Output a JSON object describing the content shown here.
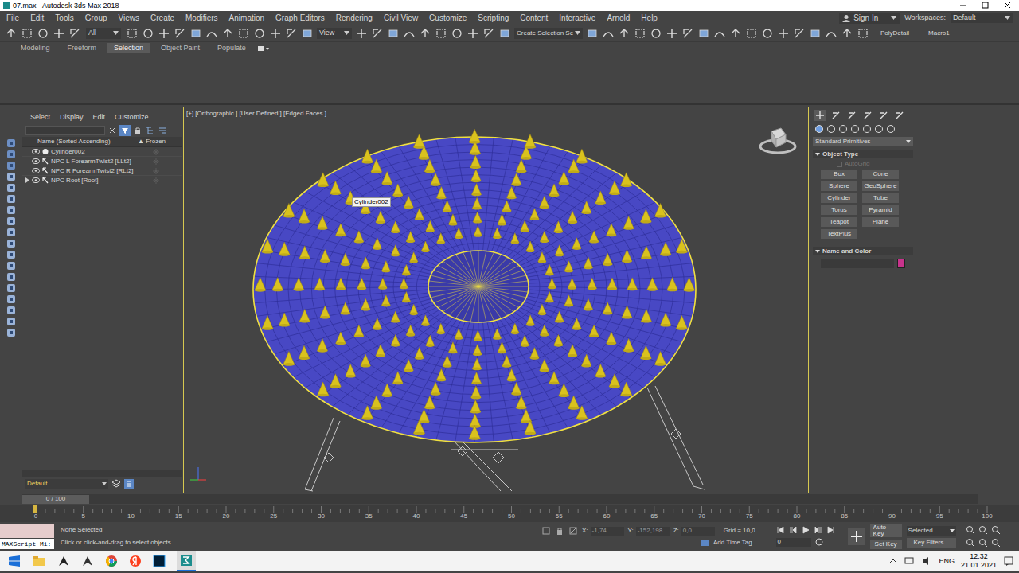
{
  "window": {
    "title": "07.max - Autodesk 3ds Max 2018"
  },
  "menu_bar": {
    "items": [
      "File",
      "Edit",
      "Tools",
      "Group",
      "Views",
      "Create",
      "Modifiers",
      "Animation",
      "Graph Editors",
      "Rendering",
      "Civil View",
      "Customize",
      "Scripting",
      "Content",
      "Interactive",
      "Arnold",
      "Help"
    ],
    "sign_in": "Sign In",
    "workspaces_label": "Workspaces:",
    "workspace": "Default"
  },
  "main_toolbar": {
    "filter": "All",
    "reference": "View",
    "selection_set": "Create Selection Se",
    "buttons": [
      "PolyDetail",
      "Macro1"
    ]
  },
  "ribbon": {
    "tabs": [
      {
        "label": "Modeling",
        "selected": false
      },
      {
        "label": "Freeform",
        "selected": false
      },
      {
        "label": "Selection",
        "selected": true
      },
      {
        "label": "Object Paint",
        "selected": false
      },
      {
        "label": "Populate",
        "selected": false
      }
    ]
  },
  "scene_explorer": {
    "menu": [
      "Select",
      "Display",
      "Edit",
      "Customize"
    ],
    "columns": [
      "Name (Sorted Ascending)",
      "▲ Frozen"
    ],
    "rows": [
      {
        "name": "Cylinder002",
        "kind": "geometry",
        "expandable": false,
        "expanded": false
      },
      {
        "name": "NPC L ForearmTwist2 [LLt2]",
        "kind": "bone",
        "expandable": false,
        "expanded": false
      },
      {
        "name": "NPC R ForearmTwist2 [RLt2]",
        "kind": "bone",
        "expandable": false,
        "expanded": false
      },
      {
        "name": "NPC Root [Root]",
        "kind": "bone",
        "expandable": true,
        "expanded": false
      }
    ],
    "layer": "Default"
  },
  "viewport": {
    "label": "[+] [Orthographic ] [User Defined ] [Edged Faces ]",
    "tooltip": "Cylinder002",
    "active": true
  },
  "command_panel": {
    "category": "Standard Primitives",
    "object_type": {
      "title": "Object Type",
      "autogrid": {
        "label": "AutoGrid",
        "checked": false,
        "disabled": true
      },
      "buttons": [
        "Box",
        "Cone",
        "Sphere",
        "GeoSphere",
        "Cylinder",
        "Tube",
        "Torus",
        "Pyramid",
        "Teapot",
        "Plane",
        "TextPlus"
      ]
    },
    "name_and_color": {
      "title": "Name and Color",
      "color": "#c8338c"
    }
  },
  "timeline": {
    "frame": "0 / 100",
    "level": 0,
    "ticks": [
      "0",
      "5",
      "10",
      "15",
      "20",
      "25",
      "30",
      "35",
      "40",
      "45",
      "50",
      "55",
      "60",
      "65",
      "70",
      "75",
      "80",
      "85",
      "90",
      "95",
      "100"
    ]
  },
  "status": {
    "maxscript": "MAXScript Mi:",
    "selection": "None Selected",
    "prompt": "Click or click-and-drag to select objects",
    "x_label": "X:",
    "x": "-1,74",
    "y_label": "Y:",
    "y": "-152,198",
    "z_label": "Z:",
    "z": "0,0",
    "grid": "Grid = 10,0",
    "time_tag": "Add Time Tag",
    "auto_key": "Auto Key",
    "key_mode": "Selected",
    "set_key": "Set Key",
    "key_filters": "Key Filters...",
    "current_frame": "0"
  },
  "taskbar": {
    "language": "ENG",
    "time": "12:32",
    "date": "21.01.2021"
  }
}
